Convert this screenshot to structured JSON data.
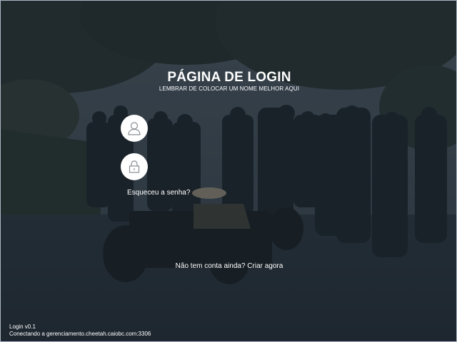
{
  "login": {
    "title": "PÁGINA DE LOGIN",
    "subtitle": "LEMBRAR DE COLOCAR UM NOME MELHOR AQUI",
    "user_icon": "user-icon",
    "password_icon": "lock-icon",
    "username_value": "",
    "password_value": "",
    "forgot_password": "Esqueceu a senha?",
    "signup": "Não tem conta ainda? Criar agora"
  },
  "footer": {
    "version": "Login v0.1",
    "connection": "Conectando a gerenciamento.cheetah.caiobc.com:3306"
  },
  "colors": {
    "overlay": "#19232c",
    "text": "#ffffff",
    "icon_background": "#ffffff",
    "icon_stroke": "#8a8f94"
  }
}
